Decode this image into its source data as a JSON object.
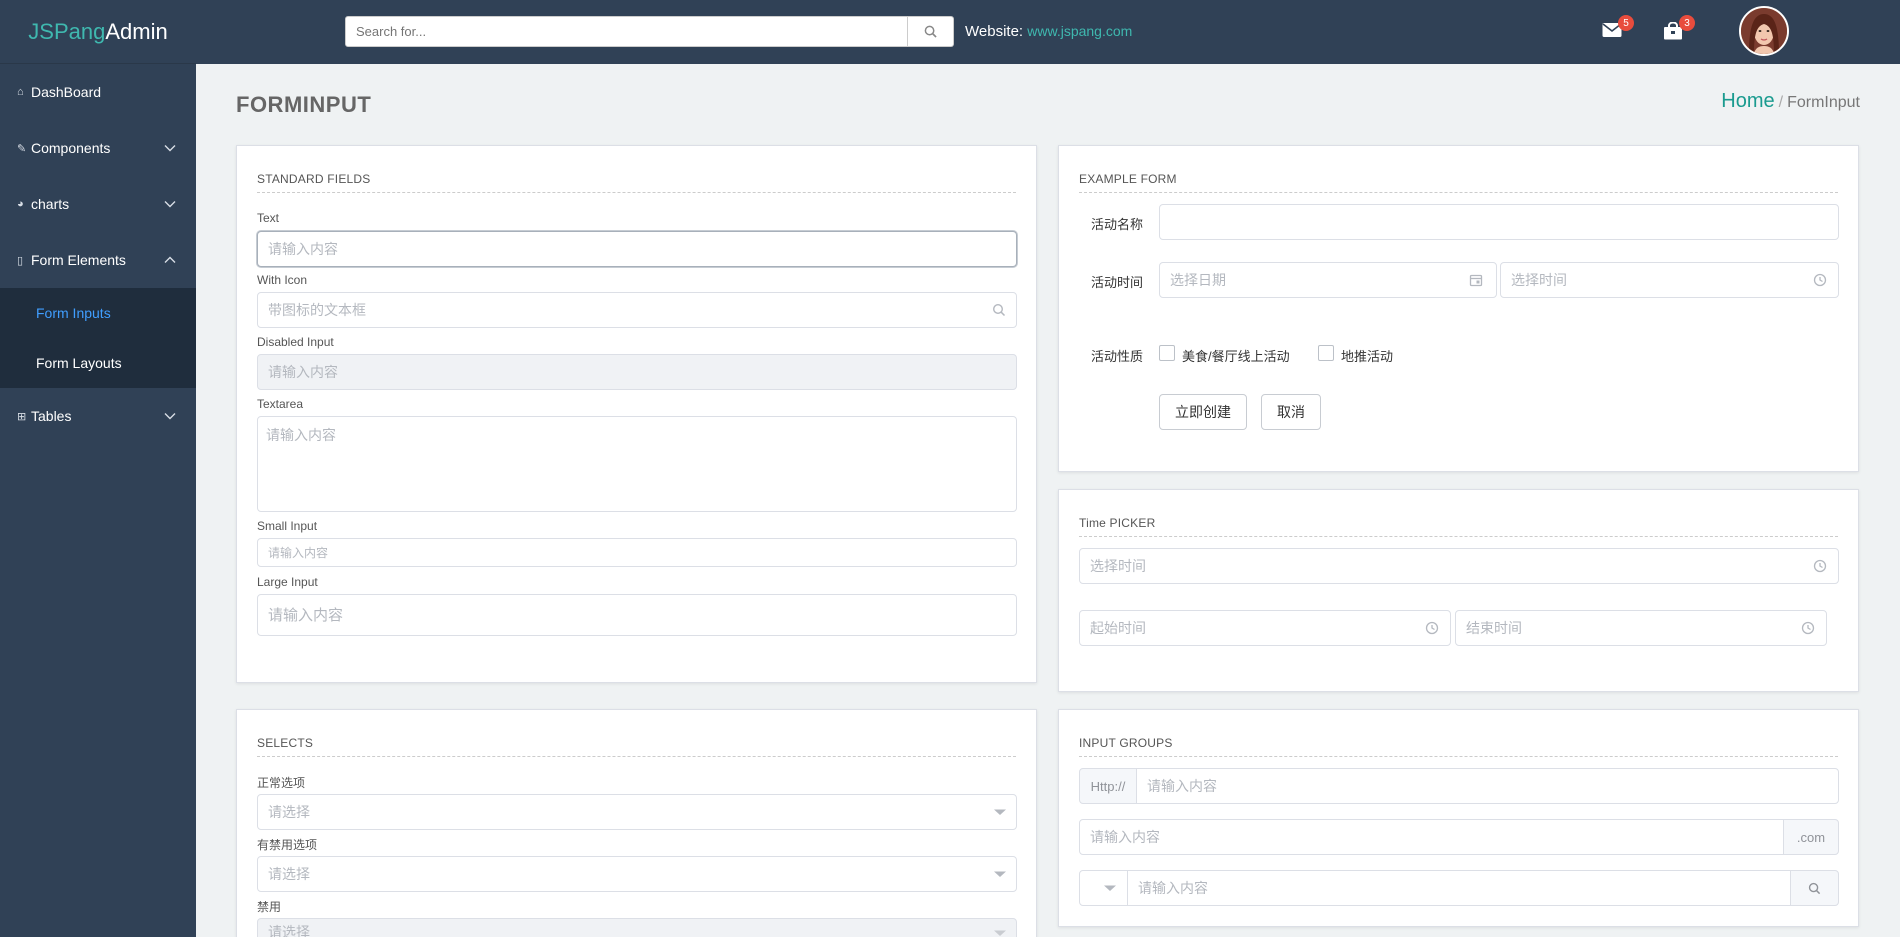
{
  "brand": {
    "part1": "JSPang",
    "part2": "Admin"
  },
  "header": {
    "search_placeholder": "Search for...",
    "website_label": "Website:",
    "website_link": "www.jspang.com",
    "mail_badge": "5",
    "notify_badge": "3"
  },
  "sidebar": {
    "items": [
      {
        "label": "DashBoard"
      },
      {
        "label": "Components"
      },
      {
        "label": "charts"
      },
      {
        "label": "Form Elements"
      },
      {
        "label": "Tables"
      }
    ],
    "sub_items": [
      {
        "label": "Form Inputs"
      },
      {
        "label": "Form Layouts"
      }
    ]
  },
  "page": {
    "title": "FORMINPUT",
    "breadcrumb_home": "Home",
    "breadcrumb_sep": "/",
    "breadcrumb_current": "FormInput"
  },
  "standard": {
    "title": "STANDARD FIELDS",
    "text_label": "Text",
    "text_placeholder": "请输入内容",
    "icon_label": "With Icon",
    "icon_placeholder": "带图标的文本框",
    "disabled_label": "Disabled Input",
    "disabled_placeholder": "请输入内容",
    "textarea_label": "Textarea",
    "textarea_placeholder": "请输入内容",
    "small_label": "Small Input",
    "small_placeholder": "请输入内容",
    "large_label": "Large Input",
    "large_placeholder": "请输入内容"
  },
  "example": {
    "title": "EXAMPLE FORM",
    "name_label": "活动名称",
    "time_label": "活动时间",
    "date_placeholder": "选择日期",
    "time_placeholder": "选择时间",
    "type_label": "活动性质",
    "option1": "美食/餐厅线上活动",
    "option2": "地推活动",
    "create_button": "立即创建",
    "cancel_button": "取消"
  },
  "timepicker": {
    "title": "Time PICKER",
    "time_placeholder": "选择时间",
    "start_placeholder": "起始时间",
    "end_placeholder": "结束时间"
  },
  "selects": {
    "title": "SELECTS",
    "normal_label": "正常选项",
    "normal_placeholder": "请选择",
    "with_disabled_label": "有禁用选项",
    "with_disabled_placeholder": "请选择",
    "disabled_label": "禁用",
    "disabled_placeholder": "请选择"
  },
  "groups": {
    "title": "INPUT GROUPS",
    "prefix": "Http://",
    "input1_placeholder": "请输入内容",
    "input2_placeholder": "请输入内容",
    "suffix": ".com",
    "input3_placeholder": "请输入内容"
  }
}
